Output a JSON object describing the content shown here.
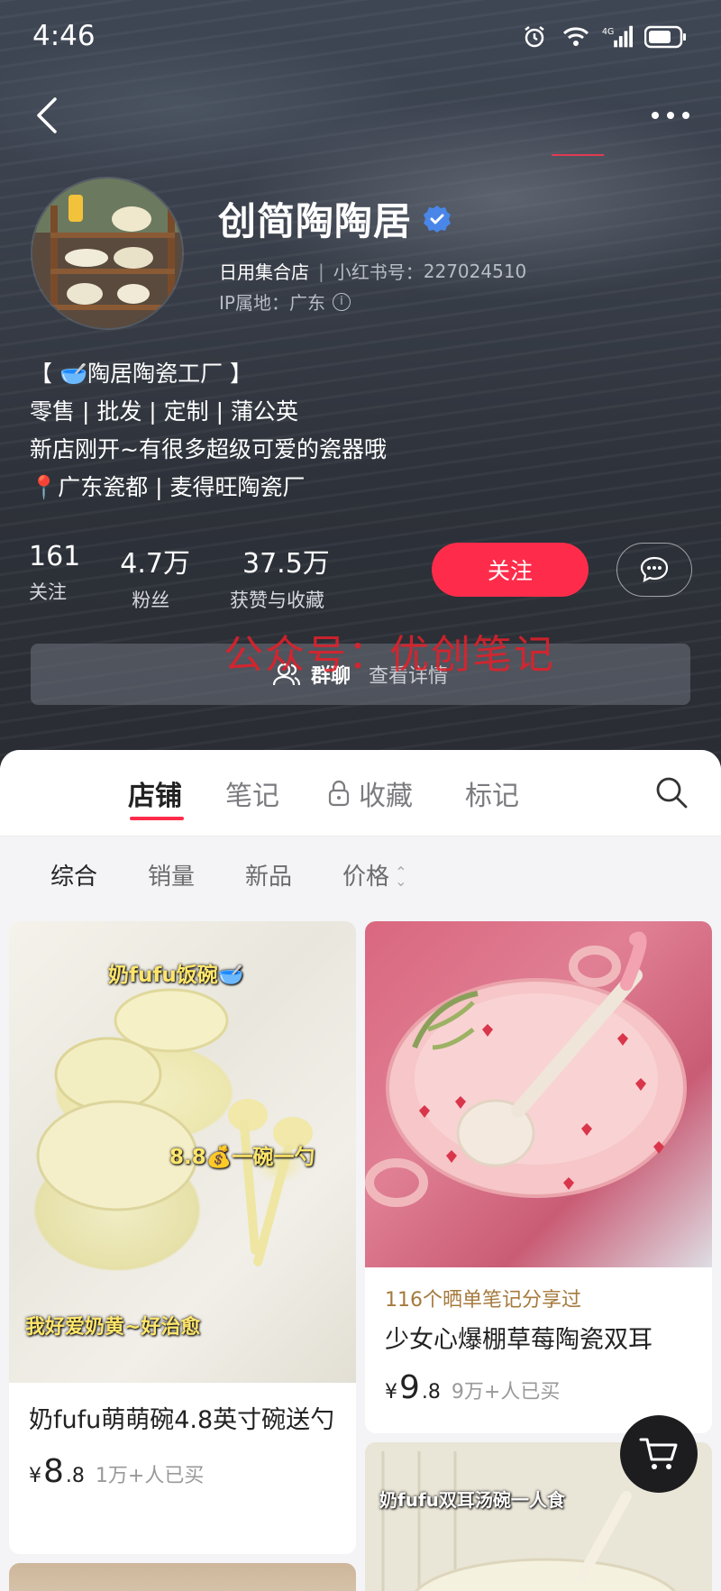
{
  "status_bar": {
    "time": "4:46",
    "network": "4G"
  },
  "shop": {
    "name": "创简陶陶居",
    "store_type": "日用集合店",
    "xhs_id_label": "小红书号：",
    "xhs_id": "227024510",
    "ip_label": "IP属地：",
    "ip_location": "广东",
    "bio": [
      "【 🥣陶居陶瓷工厂 】",
      "零售 | 批发 | 定制 | 蒲公英",
      "新店刚开~有很多超级可爱的瓷器哦",
      "📍广东瓷都 | 麦得旺陶瓷厂"
    ]
  },
  "stats": [
    {
      "num": "161",
      "label": "关注"
    },
    {
      "num": "4.7万",
      "label": "粉丝"
    },
    {
      "num": "37.5万",
      "label": "获赞与收藏"
    }
  ],
  "actions": {
    "follow": "关注"
  },
  "watermark": "公众号：优创笔记",
  "group": {
    "title": "群聊",
    "detail": "查看详情"
  },
  "tabs": [
    {
      "label": "店铺"
    },
    {
      "label": "笔记"
    },
    {
      "label": "收藏"
    },
    {
      "label": "标记"
    }
  ],
  "filters": [
    {
      "label": "综合"
    },
    {
      "label": "销量"
    },
    {
      "label": "新品"
    },
    {
      "label": "价格"
    }
  ],
  "products": [
    {
      "overlay_top": "奶fufu饭碗🥣",
      "overlay_mid": "8.8💰一碗一勺",
      "overlay_bottom": "我好爱奶黄~好治愈",
      "title": "奶fufu萌萌碗4.8英寸碗送勺",
      "yen": "¥",
      "price_int": "8",
      "price_dec": ".8",
      "sold": "1万+人已买"
    },
    {
      "shared": "116个晒单笔记分享过",
      "title": "少女心爆棚草莓陶瓷双耳",
      "yen": "¥",
      "price_int": "9",
      "price_dec": ".8",
      "sold": "9万+人已买"
    },
    {
      "overlay_top": "奶fufu双耳汤碗一人食"
    }
  ],
  "colors": {
    "accent": "#fe2c4a",
    "verified": "#4a86e8"
  }
}
